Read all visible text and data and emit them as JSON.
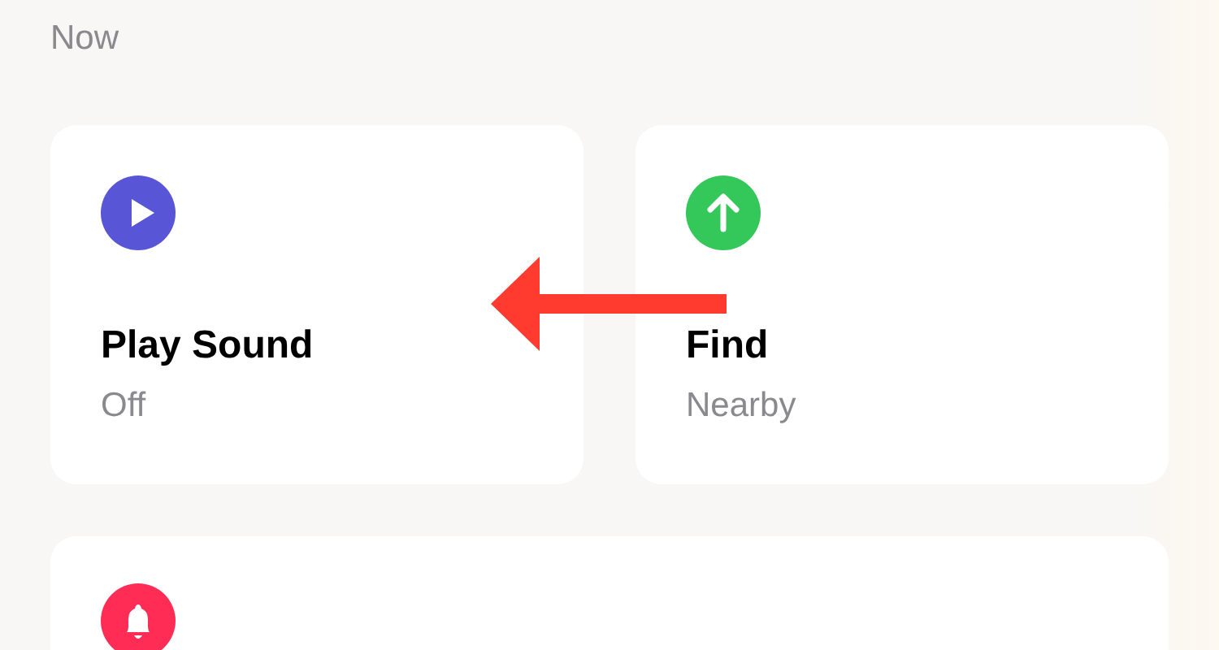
{
  "status": "Now",
  "tiles": [
    {
      "kind": "play",
      "title": "Play Sound",
      "subtitle": "Off",
      "color": "#5856d6"
    },
    {
      "kind": "up",
      "title": "Find",
      "subtitle": "Nearby",
      "color": "#34c759"
    },
    {
      "kind": "bell",
      "color": "#ff2d55"
    }
  ],
  "annotation": {
    "kind": "arrow"
  }
}
